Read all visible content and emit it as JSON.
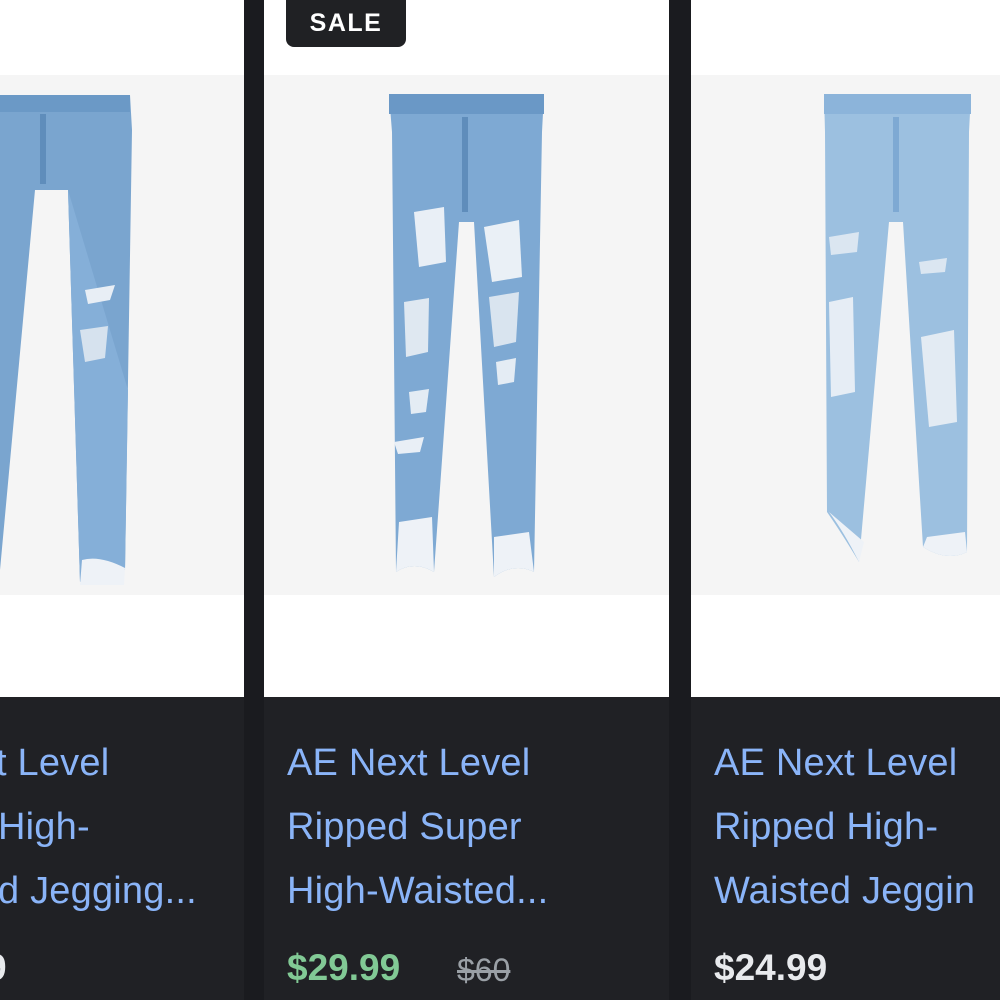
{
  "colors": {
    "link_blue": "#8ab4f8",
    "sale_green": "#81c995",
    "strike_gray": "#9aa0a6",
    "price_white": "#e8eaed",
    "card_dark": "#202125"
  },
  "cards": [
    {
      "title_lines": [
        "t Level",
        "High-",
        "d Jegging..."
      ],
      "price": "9"
    },
    {
      "badge": "SALE",
      "title_lines": [
        "AE Next Level",
        "Ripped Super",
        "High-Waisted..."
      ],
      "price": "$29.99",
      "original_price": "$60"
    },
    {
      "title_lines": [
        "AE Next Level",
        "Ripped High-",
        "Waisted Jeggin"
      ],
      "price": "$24.99"
    }
  ]
}
